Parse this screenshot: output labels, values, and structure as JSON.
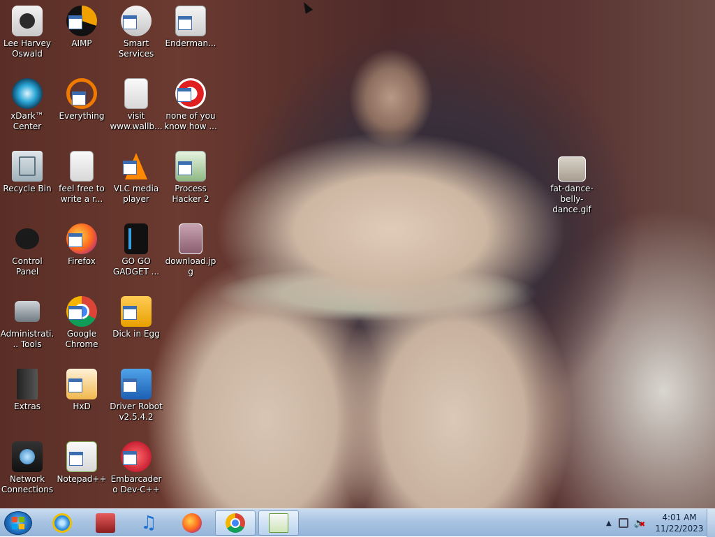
{
  "desktop": {
    "icons": [
      {
        "label": "Lee Harvey Oswald",
        "icon": "anime-character-icon"
      },
      {
        "label": "AIMP",
        "icon": "aimp-icon"
      },
      {
        "label": "Smart Services",
        "icon": "gears-icon"
      },
      {
        "label": "Enderman...",
        "icon": "window-icon"
      },
      {
        "label": "xDark™ Center",
        "icon": "xdark-icon"
      },
      {
        "label": "Everything",
        "icon": "everything-search-icon"
      },
      {
        "label": "visit www.wallb...",
        "icon": "text-document-icon"
      },
      {
        "label": "none of you know how ...",
        "icon": "red-swirl-icon"
      },
      {
        "label": "Recycle Bin",
        "icon": "recycle-bin-icon"
      },
      {
        "label": "feel free to write a r...",
        "icon": "text-document-icon"
      },
      {
        "label": "VLC media player",
        "icon": "vlc-cone-icon"
      },
      {
        "label": "Process Hacker 2",
        "icon": "process-hacker-icon"
      },
      {
        "label": "fat-dance-belly-dance.gif",
        "icon": "gif-image-icon"
      },
      {
        "label": "Control Panel",
        "icon": "control-panel-icon"
      },
      {
        "label": "Firefox",
        "icon": "firefox-icon"
      },
      {
        "label": "GO GO GADGET ...",
        "icon": "black-device-icon"
      },
      {
        "label": "download.jpg",
        "icon": "jpg-image-icon"
      },
      {
        "label": "Administrative Tools",
        "icon": "admin-tools-icon"
      },
      {
        "label": "Google Chrome",
        "icon": "chrome-icon"
      },
      {
        "label": "Dick in Egg",
        "icon": "egg-app-icon"
      },
      {
        "label": "Extras",
        "icon": "folder-icon"
      },
      {
        "label": "HxD",
        "icon": "hxd-icon"
      },
      {
        "label": "Driver Robot v2.5.4.2",
        "icon": "driver-robot-icon"
      },
      {
        "label": "Network Connections",
        "icon": "network-icon"
      },
      {
        "label": "Notepad++",
        "icon": "notepad-plus-plus-icon"
      },
      {
        "label": "Embarcadero Dev-C++",
        "icon": "devcpp-icon"
      }
    ],
    "partial_labels": {
      "admin": "Administrati... Tools"
    }
  },
  "taskbar": {
    "start": "start-orb",
    "pinned": [
      "internet-explorer",
      "media-center",
      "itunes",
      "firefox",
      "chrome",
      "notepad-plus-plus"
    ],
    "clock_time": "4:01 AM",
    "clock_date": "11/22/2023"
  },
  "colors": {
    "taskbar_top": "#c9dcf0",
    "taskbar_bottom": "#94b4d8",
    "icon_text": "#ffffff"
  }
}
